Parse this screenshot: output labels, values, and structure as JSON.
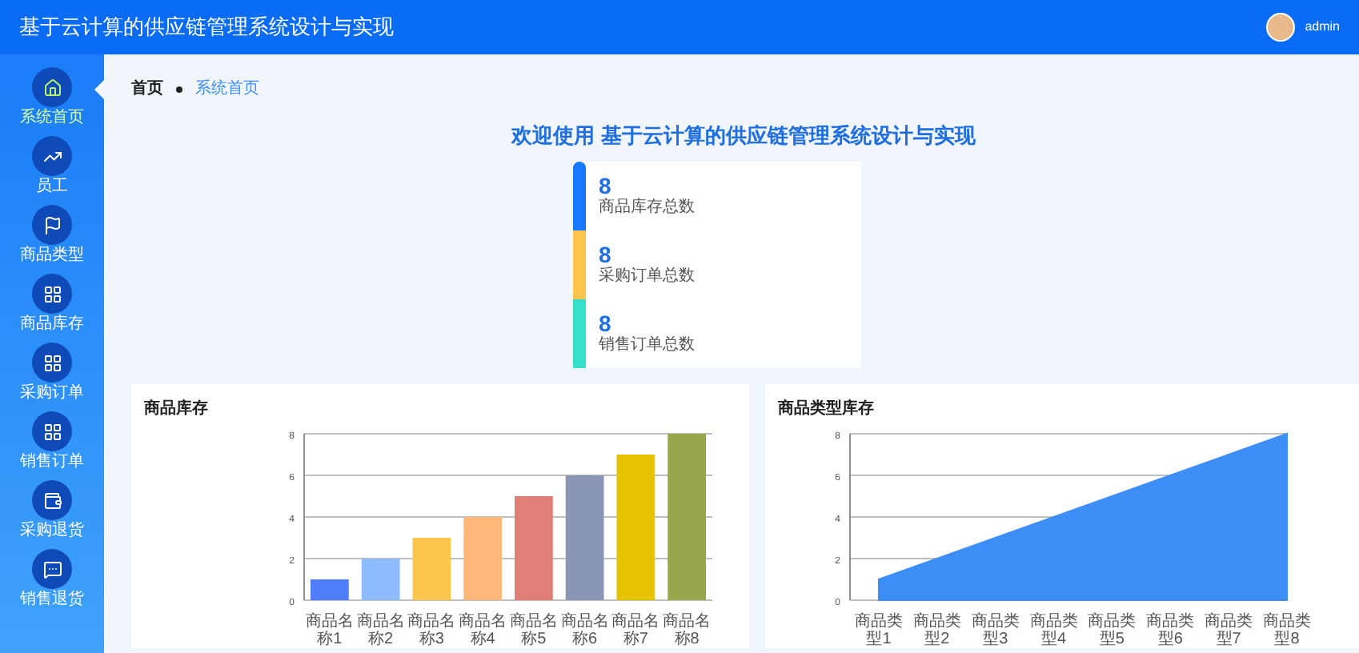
{
  "header": {
    "title": "基于云计算的供应链管理系统设计与实现",
    "user": "admin"
  },
  "sidebar": {
    "items": [
      {
        "label": "系统首页",
        "selected": true
      },
      {
        "label": "员工",
        "selected": false
      },
      {
        "label": "商品类型",
        "selected": false
      },
      {
        "label": "商品库存",
        "selected": false
      },
      {
        "label": "采购订单",
        "selected": false
      },
      {
        "label": "销售订单",
        "selected": false
      },
      {
        "label": "采购退货",
        "selected": false
      },
      {
        "label": "销售退货",
        "selected": false
      }
    ]
  },
  "breadcrumb": [
    "首页",
    "系统首页"
  ],
  "welcome": "欢迎使用 基于云计算的供应链管理系统设计与实现",
  "stats": [
    {
      "value": "8",
      "label": "商品库存总数",
      "color": "#1677ff"
    },
    {
      "value": "8",
      "label": "采购订单总数",
      "color": "#ffc54d"
    },
    {
      "value": "8",
      "label": "销售订单总数",
      "color": "#35e0c8"
    }
  ],
  "charts": [
    {
      "title": "商品库存",
      "chart_data": {
        "type": "bar",
        "categories": [
          "商品名称1",
          "商品名称2",
          "商品名称3",
          "商品名称4",
          "商品名称5",
          "商品名称6",
          "商品名称7",
          "商品名称8"
        ],
        "colors": [
          "#4f7df9",
          "#8fbcff",
          "#ffc54d",
          "#ffb77a",
          "#e07f78",
          "#8a97b4",
          "#e6c400",
          "#96a84b"
        ],
        "series": [
          {
            "values": [
              1,
              2,
              3,
              4,
              5,
              6,
              7,
              8
            ]
          }
        ],
        "ylim": [
          0,
          8
        ],
        "yticks": [
          0,
          2,
          4,
          6,
          8
        ],
        "grid": true
      }
    },
    {
      "title": "商品类型库存",
      "chart_data": {
        "type": "area",
        "categories": [
          "商品类型1",
          "商品类型2",
          "商品类型3",
          "商品类型4",
          "商品类型5",
          "商品类型6",
          "商品类型7",
          "商品类型8"
        ],
        "series": [
          {
            "color": "#3d8ef7",
            "values": [
              1,
              2,
              3,
              4,
              5,
              6,
              7,
              8
            ]
          }
        ],
        "ylim": [
          0,
          8
        ],
        "yticks": [
          0,
          2,
          4,
          6,
          8
        ],
        "grid": true
      }
    }
  ]
}
